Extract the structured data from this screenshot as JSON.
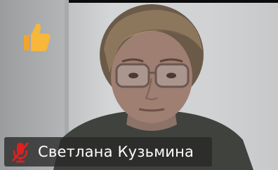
{
  "participant": {
    "name": "Светлана Кузьмина",
    "mic_status_icon": "mic-muted-icon",
    "reaction_icon": "thumbs-up-icon"
  },
  "colors": {
    "name_bar_bg": "#282828",
    "name_text": "#ffffff",
    "mic_muted": "#e02020",
    "reaction": "#f7b73a"
  }
}
